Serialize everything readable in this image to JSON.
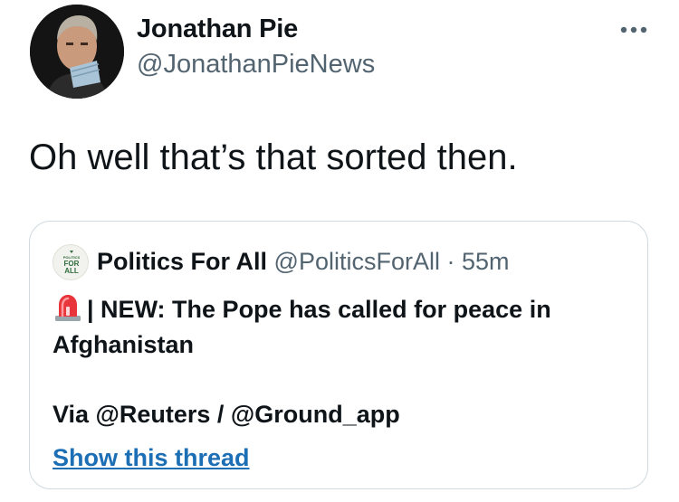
{
  "author": {
    "display_name": "Jonathan Pie",
    "handle": "@JonathanPieNews",
    "avatar_icon": "profile-photo-avatar"
  },
  "tweet": {
    "text": "Oh well that’s that sorted then."
  },
  "menu": {
    "icon": "more-options-icon"
  },
  "quoted_tweet": {
    "author_name": "Politics For All",
    "author_handle": "@PoliticsForAll",
    "separator": "·",
    "time": "55m",
    "avatar_text_top": "POLITICS",
    "avatar_text_bottom1": "FOR",
    "avatar_text_bottom2": "ALL",
    "siren_icon": "police-siren-emoji-icon",
    "body_line": "| NEW: The Pope has called for peace in Afghanistan",
    "via_line": "Via @Reuters / @Ground_app",
    "show_thread": "Show this thread"
  },
  "colors": {
    "text_primary": "#0f1419",
    "text_secondary": "#536471",
    "border": "#cfd9de",
    "link": "#1d6fb5"
  }
}
